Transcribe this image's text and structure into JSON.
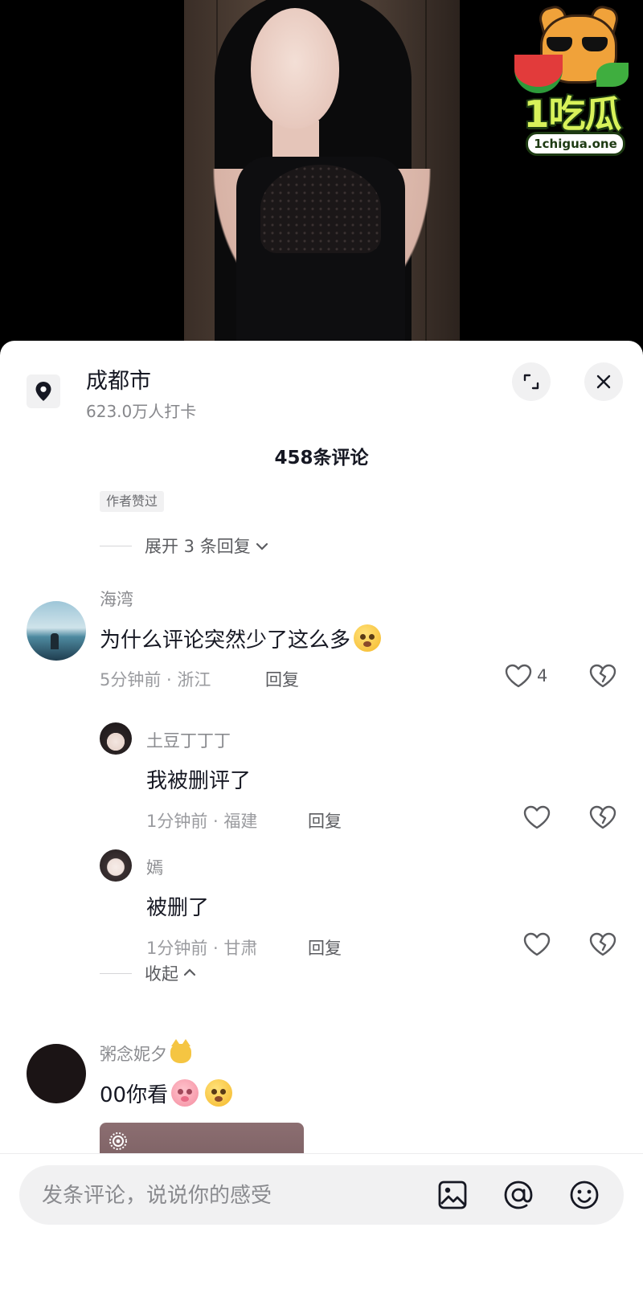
{
  "watermark": {
    "brand": "1吃瓜",
    "domain": "1chigua.one"
  },
  "location": {
    "city": "成都市",
    "checkins": "623.0万人打卡"
  },
  "comments_header": {
    "count_label": "458条评论"
  },
  "prev_thread": {
    "badge": "作者赞过",
    "expand_label": "展开 3 条回复"
  },
  "comments": [
    {
      "user": "海湾",
      "text": "为什么评论突然少了这么多",
      "meta": "5分钟前 · 浙江",
      "reply_label": "回复",
      "likes": "4",
      "replies": [
        {
          "user": "土豆丁丁丁",
          "text": "我被删评了",
          "meta": "1分钟前 · 福建",
          "reply_label": "回复"
        },
        {
          "user": "嫣",
          "text": "被删了",
          "meta": "1分钟前 · 甘肃",
          "reply_label": "回复"
        }
      ],
      "collapse_label": "收起"
    },
    {
      "user": "粥念妮夕",
      "text": "00你看"
    }
  ],
  "input": {
    "placeholder": "发条评论，说说你的感受"
  },
  "colors": {
    "text_primary": "#161823",
    "text_secondary": "#8a8b8f",
    "pill_bg": "#f1f1f2"
  }
}
